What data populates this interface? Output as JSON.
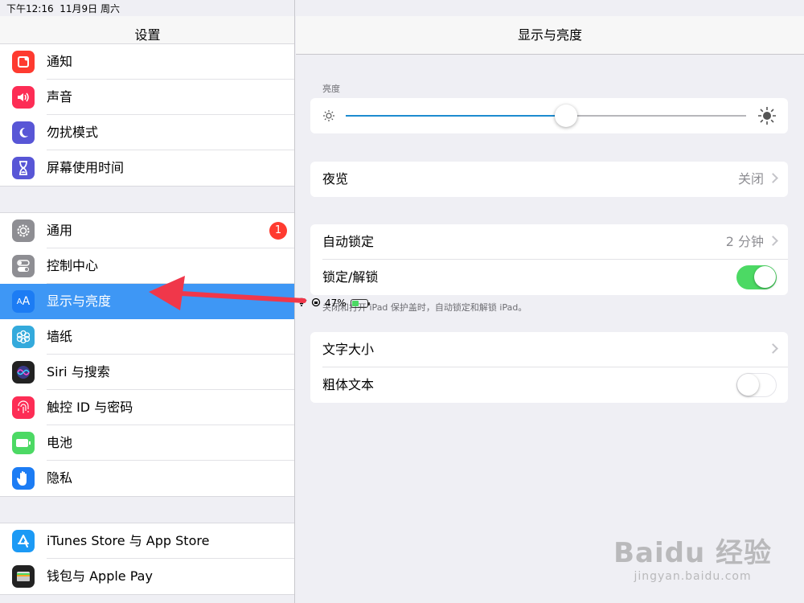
{
  "status_bar": {
    "time": "下午12:16",
    "date": "11月9日 周六",
    "battery_percent": "47%",
    "battery_level": 0.47
  },
  "sidebar": {
    "title": "设置",
    "groups": [
      {
        "items": [
          {
            "label": "通知",
            "icon": "notifications-icon",
            "color": "#fe3b30"
          },
          {
            "label": "声音",
            "icon": "sound-icon",
            "color": "#fd2d55"
          },
          {
            "label": "勿扰模式",
            "icon": "moon-icon",
            "color": "#5856d6"
          },
          {
            "label": "屏幕使用时间",
            "icon": "hourglass-icon",
            "color": "#5856d6"
          }
        ]
      },
      {
        "items": [
          {
            "label": "通用",
            "icon": "gear-icon",
            "color": "#8e8e93",
            "badge": "1"
          },
          {
            "label": "控制中心",
            "icon": "toggles-icon",
            "color": "#8e8e93"
          },
          {
            "label": "显示与亮度",
            "icon": "aa-icon",
            "color": "#1c7cf4",
            "selected": true
          },
          {
            "label": "墙纸",
            "icon": "flower-icon",
            "color": "#34aadc"
          },
          {
            "label": "Siri 与搜索",
            "icon": "siri-icon",
            "color": "#222222"
          },
          {
            "label": "触控 ID 与密码",
            "icon": "fingerprint-icon",
            "color": "#fd2d55"
          },
          {
            "label": "电池",
            "icon": "battery-icon",
            "color": "#4cd964"
          },
          {
            "label": "隐私",
            "icon": "hand-icon",
            "color": "#1c7cf4"
          }
        ]
      },
      {
        "items": [
          {
            "label": "iTunes Store 与 App Store",
            "icon": "appstore-icon",
            "color": "#1c9af5"
          },
          {
            "label": "钱包与 Apple Pay",
            "icon": "wallet-icon",
            "color": "#222222"
          }
        ]
      }
    ]
  },
  "detail": {
    "title": "显示与亮度",
    "brightness": {
      "label": "亮度",
      "level": 0.55
    },
    "night_shift": {
      "label": "夜览",
      "value": "关闭"
    },
    "auto_lock": {
      "label": "自动锁定",
      "value": "2 分钟"
    },
    "lock_unlock": {
      "label": "锁定/解锁",
      "on": true
    },
    "lock_note": "关闭和打开 iPad 保护盖时，自动锁定和解锁 iPad。",
    "text_size": {
      "label": "文字大小"
    },
    "bold_text": {
      "label": "粗体文本",
      "on": false
    }
  },
  "annotation": {
    "color": "#f0374a"
  },
  "watermark": {
    "main": "Baidu 经验",
    "sub": "jingyan.baidu.com"
  }
}
